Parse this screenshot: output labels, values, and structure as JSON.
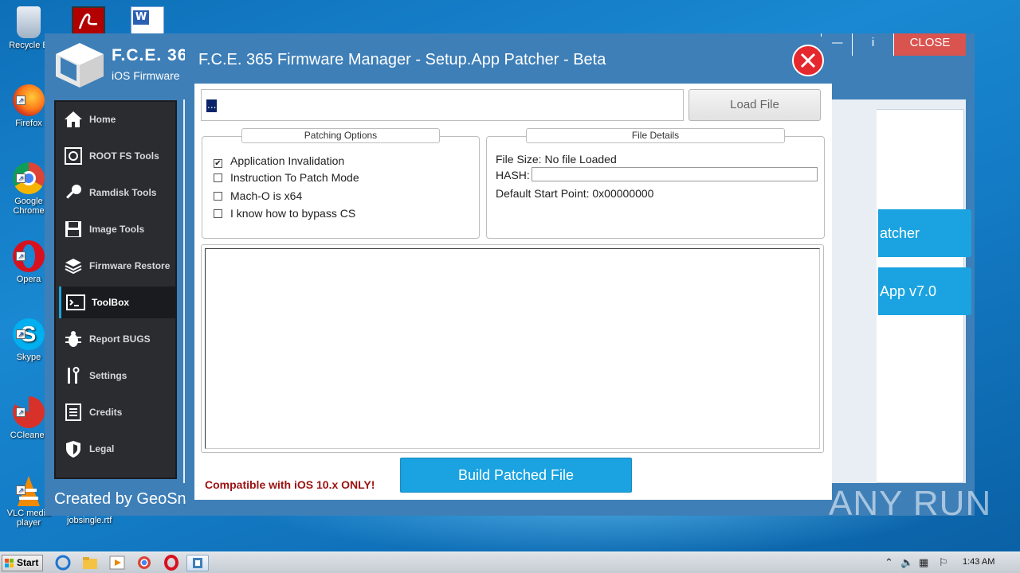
{
  "desktop": {
    "icons": [
      {
        "label": "Recycle B",
        "icon": "recycle-bin-icon"
      },
      {
        "label": "Firefox",
        "icon": "firefox-icon"
      },
      {
        "label": "Google Chrome",
        "icon": "chrome-icon"
      },
      {
        "label": "Opera",
        "icon": "opera-icon"
      },
      {
        "label": "Skype",
        "icon": "skype-icon"
      },
      {
        "label": "CCleaner",
        "icon": "ccleaner-icon"
      },
      {
        "label": "VLC media player",
        "icon": "vlc-icon"
      }
    ],
    "jobsingle_label": "jobsingle.rtf"
  },
  "app": {
    "logo_title": "F.C.E. 36",
    "logo_sub": "iOS Firmware",
    "created_by": "Created by GeoSn",
    "window_controls": {
      "info": "i",
      "close": "CLOSE"
    },
    "sidebar": [
      {
        "label": "Home",
        "icon": "home-icon"
      },
      {
        "label": "ROOT FS Tools",
        "icon": "root-fs-icon"
      },
      {
        "label": "Ramdisk Tools",
        "icon": "key-icon"
      },
      {
        "label": "Image Tools",
        "icon": "floppy-icon"
      },
      {
        "label": "Firmware Restore",
        "icon": "layers-icon"
      },
      {
        "label": "ToolBox",
        "icon": "terminal-icon"
      },
      {
        "label": "Report BUGS",
        "icon": "bug-icon"
      },
      {
        "label": "Settings",
        "icon": "tools-icon"
      },
      {
        "label": "Credits",
        "icon": "list-icon"
      },
      {
        "label": "Legal",
        "icon": "shield-icon"
      }
    ],
    "bg_buttons": [
      "atcher",
      "App v7.0"
    ]
  },
  "dialog": {
    "title": "F.C.E. 365 Firmware Manager - Setup.App Patcher - Beta",
    "file_path_value": "...",
    "load_file": "Load File",
    "patching": {
      "header": "Patching Options",
      "options": [
        {
          "label": "Application Invalidation",
          "checked": true
        },
        {
          "label": "Instruction To Patch Mode",
          "checked": false
        },
        {
          "label": "Mach-O is x64",
          "checked": false
        },
        {
          "label": "I know how to bypass CS",
          "checked": false
        }
      ]
    },
    "file_details": {
      "header": "File Details",
      "file_size": "File Size:  No file Loaded",
      "hash_label": "HASH:",
      "start_point": "Default Start Point: 0x00000000"
    },
    "compat_note": "Compatible with iOS 10.x ONLY!",
    "build_button": "Build Patched File"
  },
  "taskbar": {
    "start": "Start",
    "clock": "1:43 AM"
  },
  "watermark": "ANY RUN"
}
